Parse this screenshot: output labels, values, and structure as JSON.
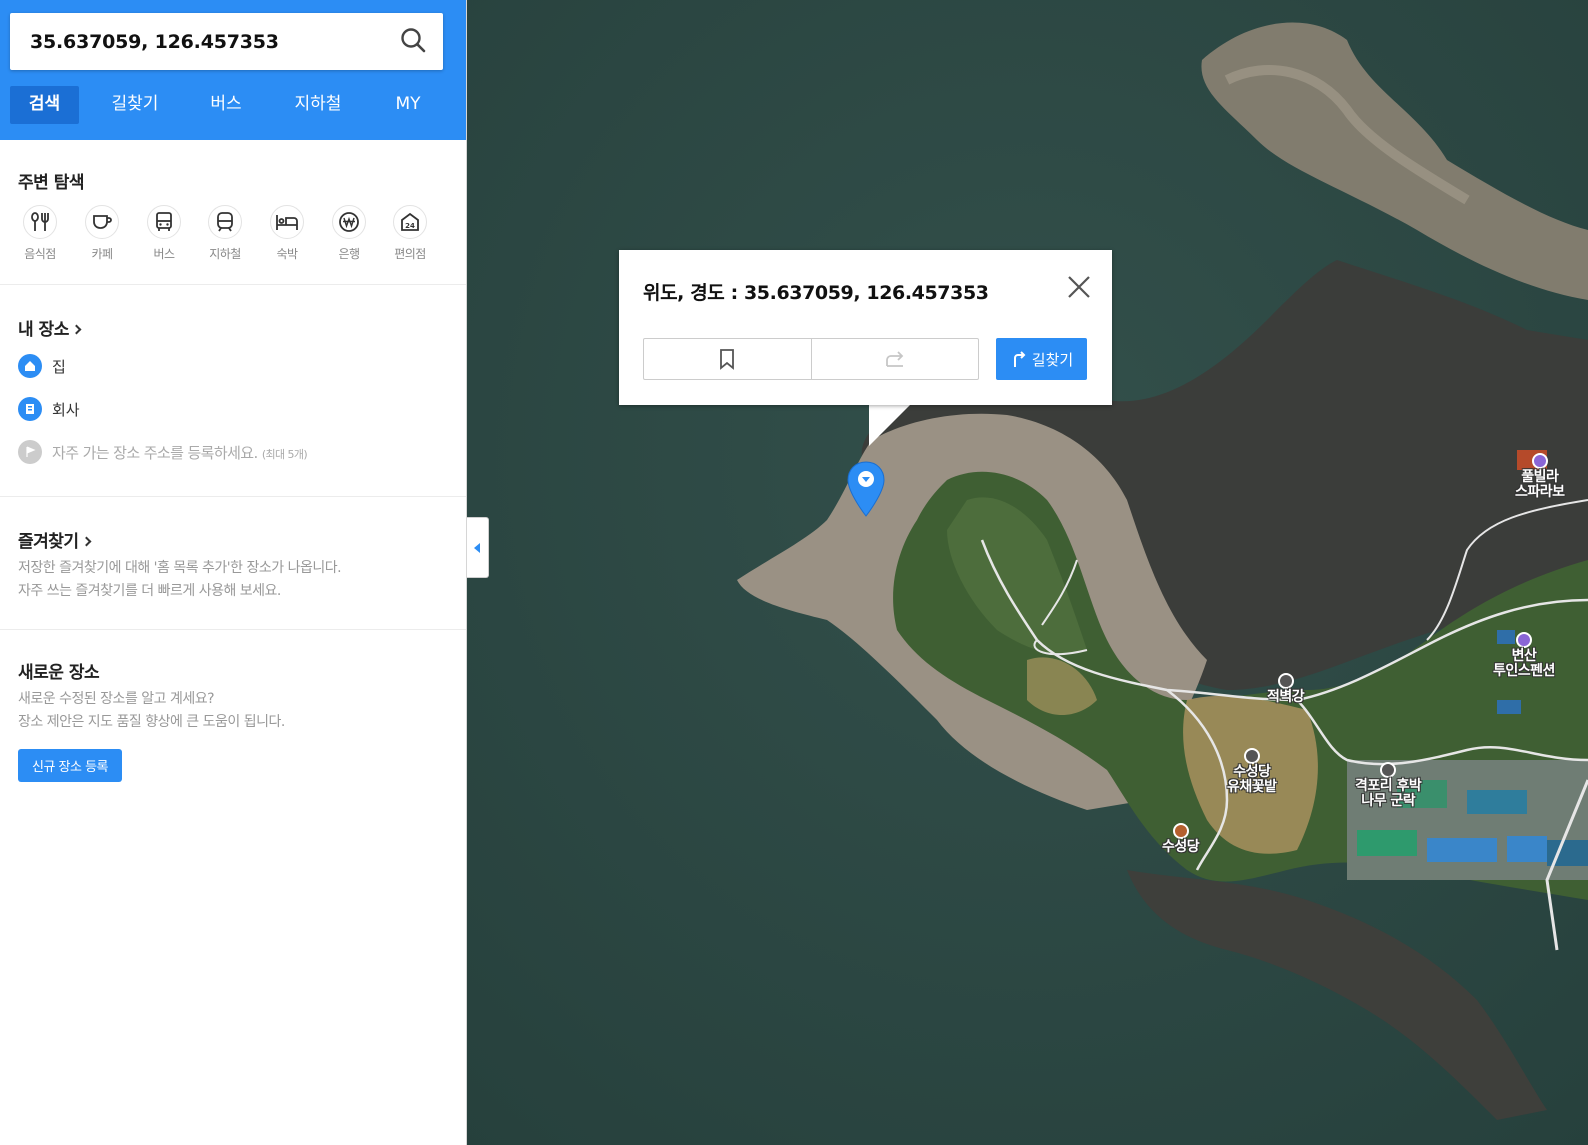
{
  "search": {
    "value": "35.637059, 126.457353"
  },
  "tabs": [
    {
      "label": "검색",
      "active": true
    },
    {
      "label": "길찾기"
    },
    {
      "label": "버스"
    },
    {
      "label": "지하철"
    },
    {
      "label": "MY"
    }
  ],
  "nearby": {
    "title": "주변 탐색",
    "categories": [
      {
        "label": "음식점",
        "icon": "fork-knife-icon"
      },
      {
        "label": "카페",
        "icon": "coffee-cup-icon"
      },
      {
        "label": "버스",
        "icon": "bus-icon"
      },
      {
        "label": "지하철",
        "icon": "subway-icon"
      },
      {
        "label": "숙박",
        "icon": "bed-icon"
      },
      {
        "label": "은행",
        "icon": "won-icon"
      },
      {
        "label": "편의점",
        "icon": "24h-store-icon"
      }
    ]
  },
  "my_places": {
    "title": "내 장소",
    "home": "집",
    "work": "회사",
    "hint": "자주 가는 장소 주소를 등록하세요.",
    "hint_small": "(최대 5개)"
  },
  "favorites": {
    "title": "즐겨찾기",
    "line1": "저장한 즐겨찾기에 대해 '홈 목록 추가'한 장소가 나옵니다.",
    "line2": "자주 쓰는 즐겨찾기를 더 빠르게 사용해 보세요."
  },
  "new_places": {
    "title": "새로운 장소",
    "line1": "새로운 수정된 장소를 알고 계세요?",
    "line2": "장소 제안은 지도 품질 향상에 큰 도움이 됩니다.",
    "button": "신규 장소 등록"
  },
  "popup": {
    "title": "위도, 경도 : 35.637059, 126.457353",
    "route_label": "길찾기"
  },
  "pois": [
    {
      "label": "적벽강",
      "icon": "camera-icon"
    },
    {
      "label": "수성당\n유채꽃밭",
      "icon": "camera-icon"
    },
    {
      "label": "격포리 후박\n나무 군락",
      "icon": "camera-icon"
    },
    {
      "label": "수성당",
      "icon": "temple-icon"
    },
    {
      "label": "변산\n투인스펜션",
      "icon": "hotel-icon"
    },
    {
      "label": "풀빌라\n스파라보",
      "icon": "hotel-icon"
    }
  ],
  "colors": {
    "accent": "#2c8df4",
    "accent_dark": "#1b6fd5",
    "sea": "#2c4743"
  }
}
